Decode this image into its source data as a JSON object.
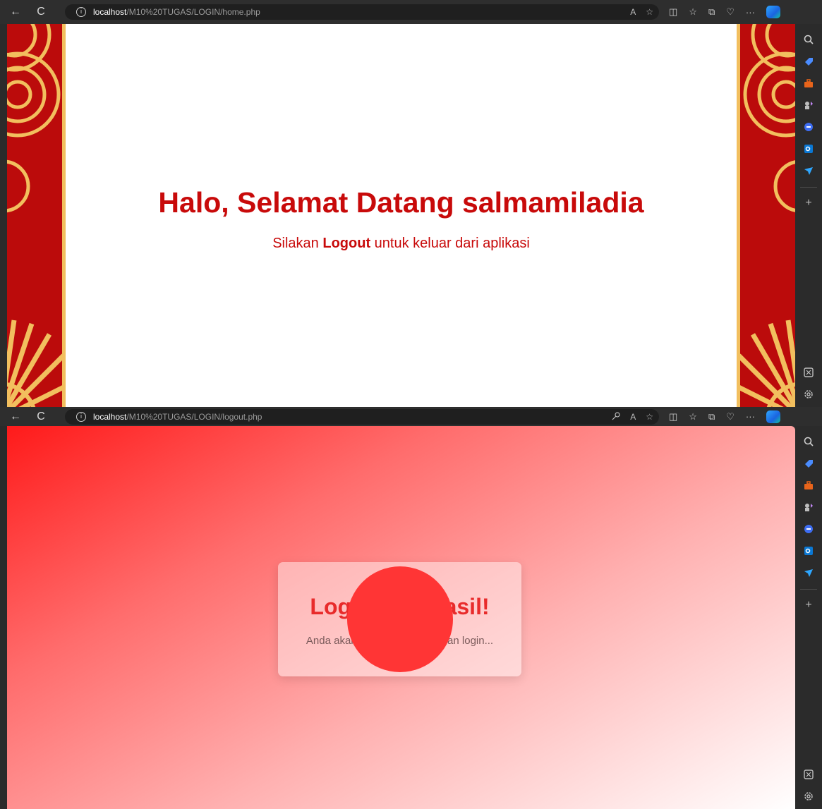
{
  "screens": [
    {
      "url_host": "localhost",
      "url_path": "/M10%20TUGAS/LOGIN/home.php",
      "heading": "Halo, Selamat Datang salmamiladia",
      "subtitle_pre": "Silakan ",
      "subtitle_bold": "Logout",
      "subtitle_post": " untuk keluar dari aplikasi"
    },
    {
      "url_host": "localhost",
      "url_path": "/M10%20TUGAS/LOGIN/logout.php",
      "card_title": "Logout Berhasil!",
      "card_text": "Anda akan dialihkan ke halaman login..."
    }
  ],
  "browser": {
    "back_icon": "←",
    "refresh_icon": "C",
    "info_icon": "i",
    "read_aloud_icon": "A",
    "favorite_icon": "☆",
    "split_icon": "◫",
    "favorites_bar_icon": "☆",
    "collections_icon": "⧉",
    "health_icon": "♡",
    "more_icon": "···",
    "sidebar_add_icon": "+"
  },
  "colors": {
    "accent_red": "#c80a0a",
    "border_red": "#bb0b0b",
    "border_gold": "#f2bf5e",
    "card_title": "#e82b2b",
    "spinner": "#ff3535"
  }
}
